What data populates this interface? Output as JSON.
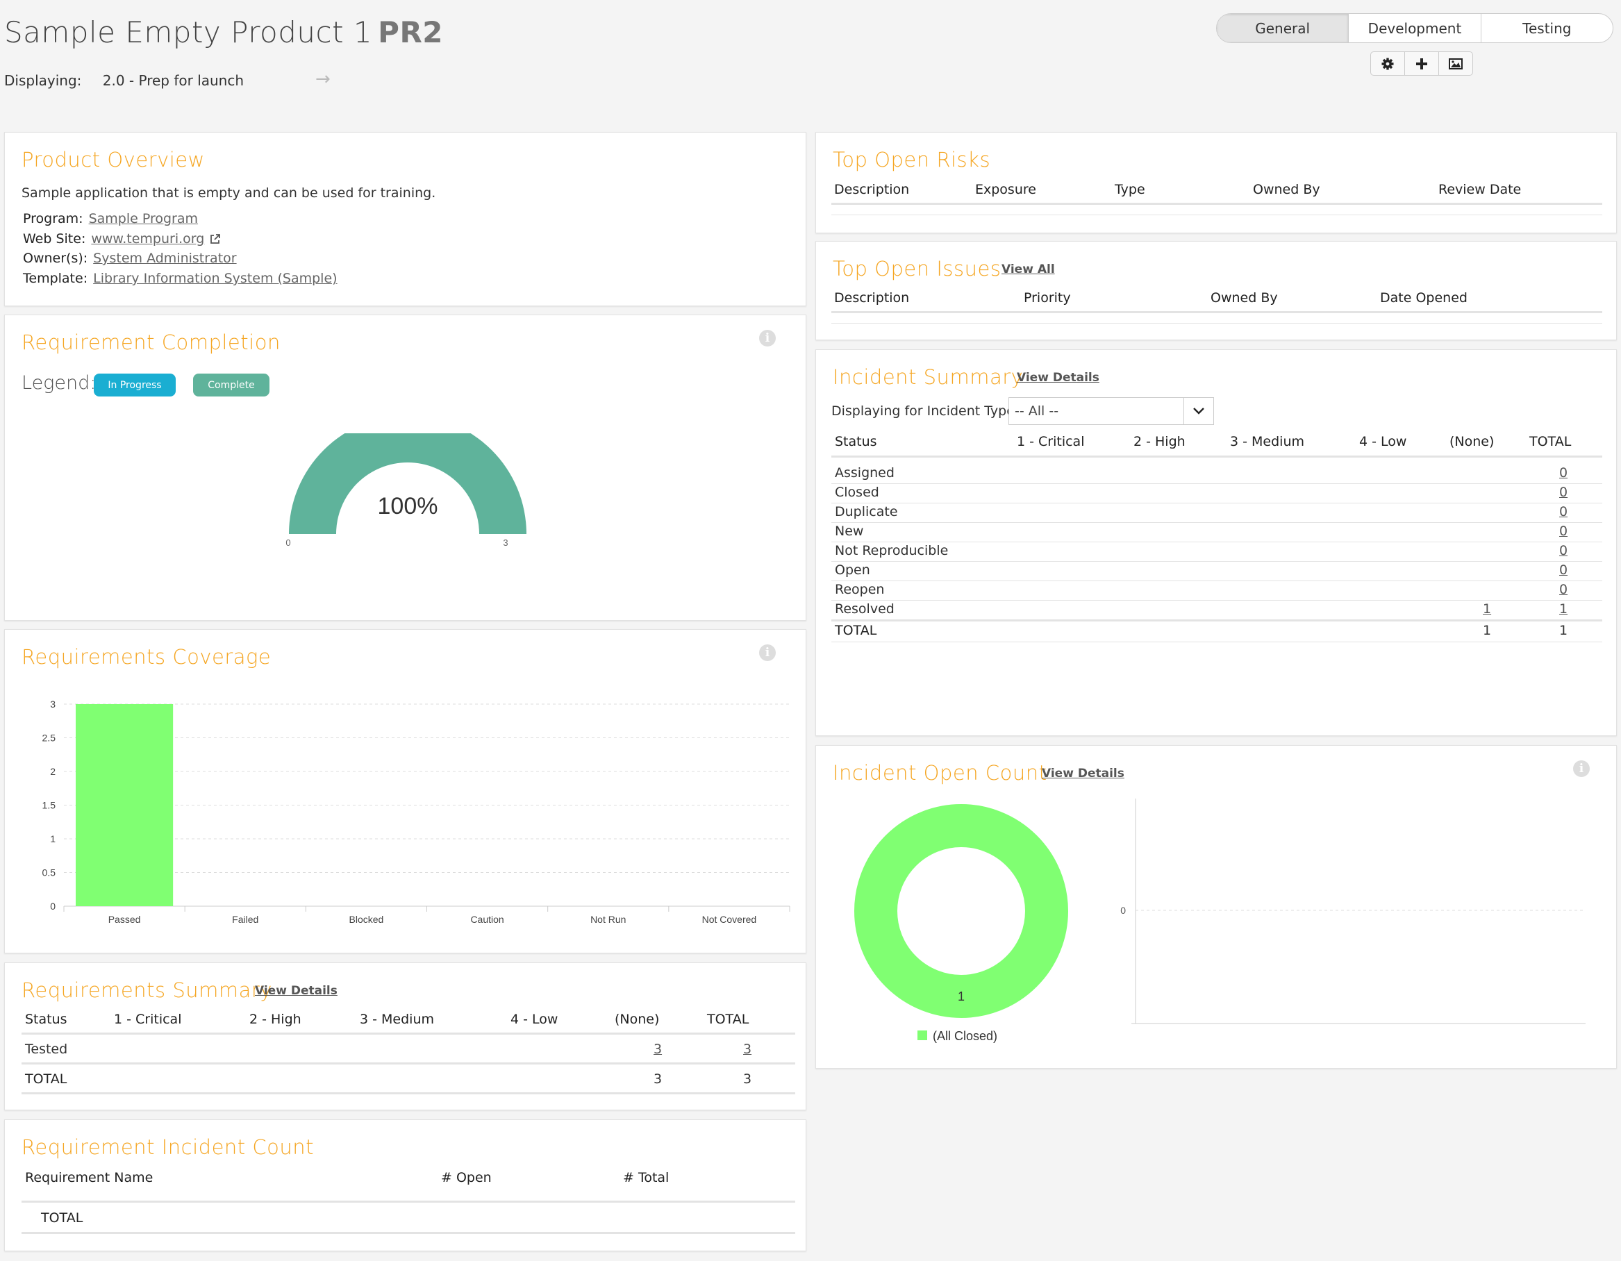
{
  "header": {
    "title": "Sample Empty Product 1",
    "code": "PR2",
    "displaying_label": "Displaying:",
    "displaying_value": "2.0 - Prep for launch",
    "tabs": [
      {
        "label": "General",
        "active": true
      },
      {
        "label": "Development",
        "active": false
      },
      {
        "label": "Testing",
        "active": false
      }
    ],
    "tools": [
      "gear-icon",
      "plus-icon",
      "image-icon"
    ]
  },
  "product_overview": {
    "title": "Product Overview",
    "description": "Sample application that is empty and can be used for training.",
    "program_label": "Program:",
    "program_value": "Sample Program",
    "website_label": "Web Site:",
    "website_value": "www.tempuri.org",
    "owners_label": "Owner(s):",
    "owners_value": "System Administrator",
    "template_label": "Template:",
    "template_value": "Library Information System (Sample)"
  },
  "requirement_completion": {
    "title": "Requirement Completion",
    "legend_label": "Legend:",
    "legend": [
      {
        "label": "In Progress",
        "color": "#1aaed2"
      },
      {
        "label": "Complete",
        "color": "#5fb39b"
      }
    ],
    "gauge_value_text": "100%",
    "gauge_min": "0",
    "gauge_max": "3",
    "gauge_fraction": 1.0,
    "gauge_color": "#5fb39b"
  },
  "requirements_coverage": {
    "title": "Requirements Coverage"
  },
  "chart_data": {
    "type": "bar",
    "categories": [
      "Passed",
      "Failed",
      "Blocked",
      "Caution",
      "Not Run",
      "Not Covered"
    ],
    "values": [
      3,
      0,
      0,
      0,
      0,
      0
    ],
    "yticks": [
      "0",
      "0.5",
      "1",
      "1.5",
      "2",
      "2.5",
      "3"
    ],
    "ylim": [
      0,
      3
    ],
    "bar_color": "#80ff72",
    "grid": true
  },
  "requirements_summary": {
    "title": "Requirements Summary",
    "link": "View Details",
    "columns": [
      "Status",
      "1 - Critical",
      "2 - High",
      "3 - Medium",
      "4 - Low",
      "(None)",
      "TOTAL"
    ],
    "rows": [
      {
        "status": "Tested",
        "none": "3",
        "total": "3"
      }
    ],
    "total_row": {
      "label": "TOTAL",
      "none": "3",
      "total": "3"
    }
  },
  "requirement_incident_count": {
    "title": "Requirement Incident Count",
    "columns": [
      "Requirement Name",
      "# Open",
      "# Total"
    ],
    "total_label": "TOTAL"
  },
  "top_open_risks": {
    "title": "Top Open Risks",
    "columns": [
      "Description",
      "Exposure",
      "Type",
      "Owned By",
      "Review Date"
    ]
  },
  "top_open_issues": {
    "title": "Top Open Issues",
    "link": "View All",
    "columns": [
      "Description",
      "Priority",
      "Owned By",
      "Date Opened"
    ]
  },
  "incident_summary": {
    "title": "Incident Summary",
    "link": "View Details",
    "filter_label": "Displaying for Incident Type:",
    "filter_value": "-- All --",
    "columns": [
      "Status",
      "1 - Critical",
      "2 - High",
      "3 - Medium",
      "4 - Low",
      "(None)",
      "TOTAL"
    ],
    "rows": [
      {
        "status": "Assigned",
        "none": "",
        "total": "0"
      },
      {
        "status": "Closed",
        "none": "",
        "total": "0"
      },
      {
        "status": "Duplicate",
        "none": "",
        "total": "0"
      },
      {
        "status": "New",
        "none": "",
        "total": "0"
      },
      {
        "status": "Not Reproducible",
        "none": "",
        "total": "0"
      },
      {
        "status": "Open",
        "none": "",
        "total": "0"
      },
      {
        "status": "Reopen",
        "none": "",
        "total": "0"
      },
      {
        "status": "Resolved",
        "none": "1",
        "total": "1"
      }
    ],
    "total_row": {
      "label": "TOTAL",
      "none": "1",
      "total": "1"
    }
  },
  "incident_open_count": {
    "title": "Incident Open Count",
    "link": "View Details",
    "donut_label": "1",
    "donut_legend": "(All Closed)",
    "donut_color": "#80ff72",
    "axis_tick": "0"
  }
}
